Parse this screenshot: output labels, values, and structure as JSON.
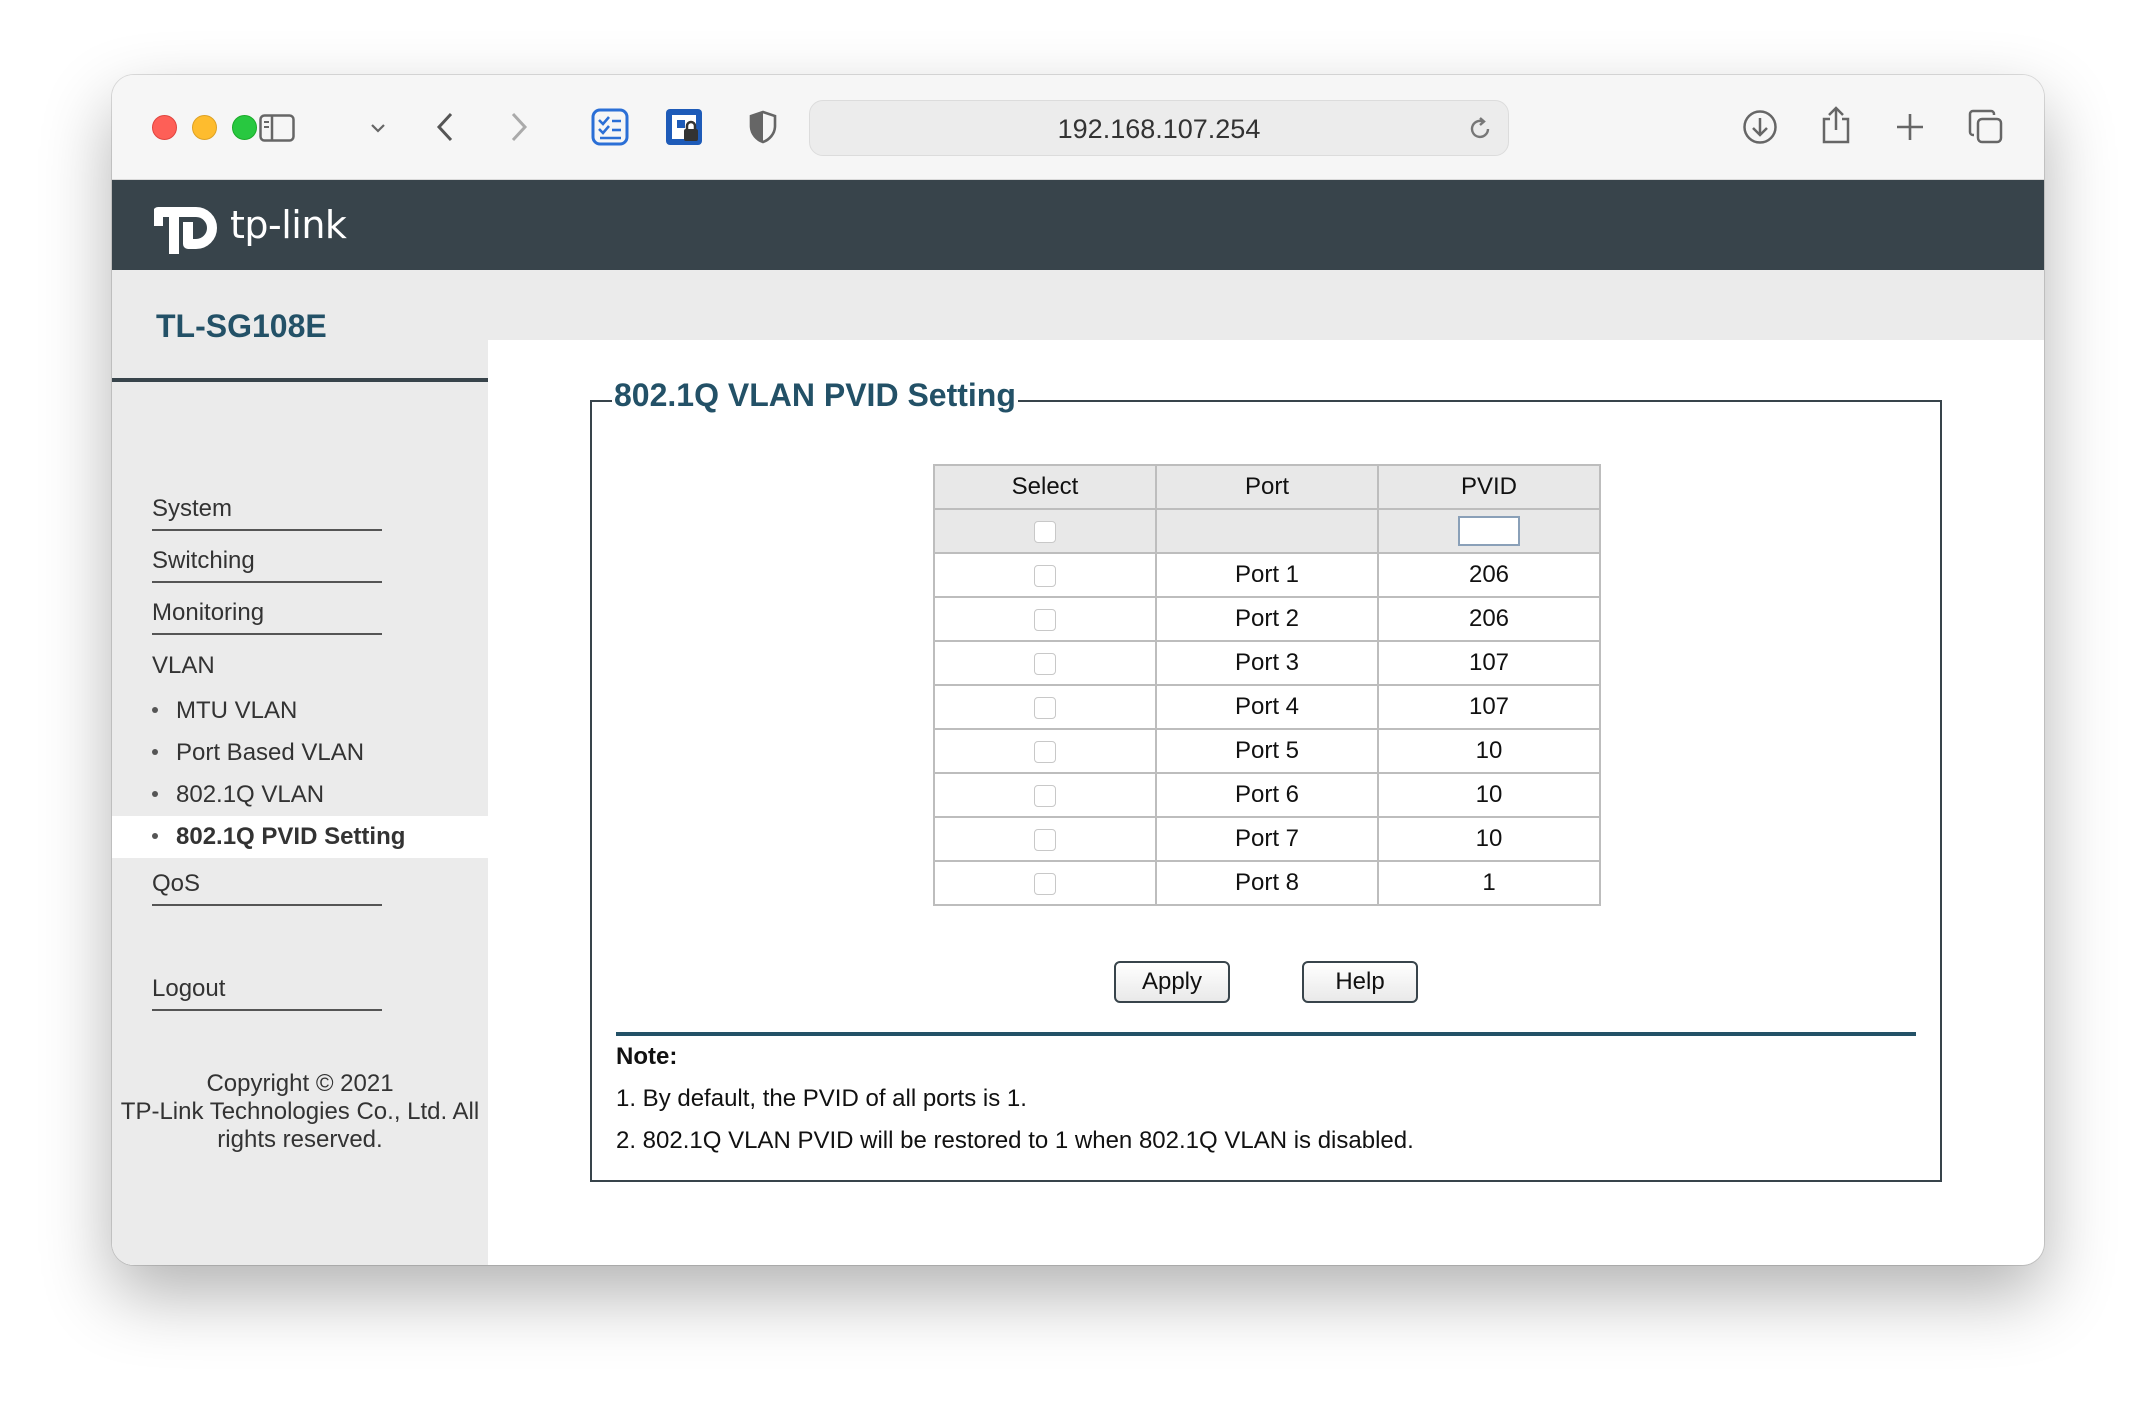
{
  "browser": {
    "url": "192.168.107.254"
  },
  "brand": {
    "logo_text": "tp-link"
  },
  "sidebar": {
    "model": "TL-SG108E",
    "items": [
      {
        "label": "System"
      },
      {
        "label": "Switching"
      },
      {
        "label": "Monitoring"
      },
      {
        "label": "VLAN"
      }
    ],
    "vlan_subitems": [
      {
        "label": "MTU VLAN"
      },
      {
        "label": "Port Based VLAN"
      },
      {
        "label": "802.1Q VLAN"
      },
      {
        "label": "802.1Q PVID Setting",
        "active": true
      }
    ],
    "qos": "QoS",
    "logout": "Logout",
    "copyright": [
      "Copyright © 2021",
      "TP-Link Technologies Co., Ltd. All",
      "rights reserved."
    ]
  },
  "content": {
    "title": "802.1Q VLAN PVID Setting",
    "table": {
      "headers": [
        "Select",
        "Port",
        "PVID"
      ],
      "pvid_input_value": "",
      "rows": [
        {
          "port": "Port 1",
          "pvid": "206"
        },
        {
          "port": "Port 2",
          "pvid": "206"
        },
        {
          "port": "Port 3",
          "pvid": "107"
        },
        {
          "port": "Port 4",
          "pvid": "107"
        },
        {
          "port": "Port 5",
          "pvid": "10"
        },
        {
          "port": "Port 6",
          "pvid": "10"
        },
        {
          "port": "Port 7",
          "pvid": "10"
        },
        {
          "port": "Port 8",
          "pvid": "1"
        }
      ]
    },
    "apply_label": "Apply",
    "help_label": "Help",
    "note_title": "Note:",
    "notes": [
      "1. By default, the PVID of all ports is 1.",
      "2. 802.1Q VLAN PVID will be restored to 1 when 802.1Q VLAN is disabled."
    ]
  }
}
